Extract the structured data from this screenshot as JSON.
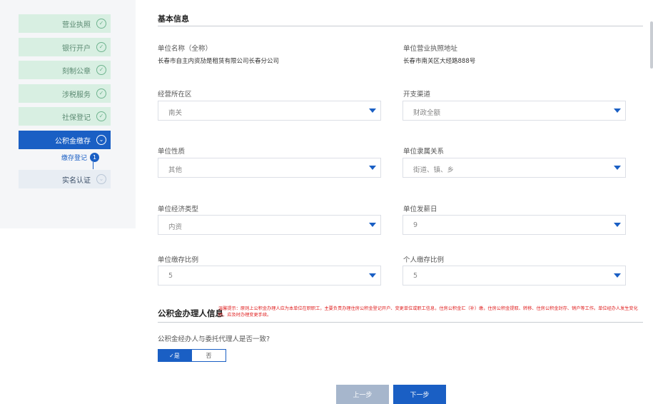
{
  "sidebar": {
    "items": [
      {
        "label": "营业执照",
        "icon": "check-circle-icon",
        "status": "done"
      },
      {
        "label": "银行开户",
        "icon": "check-circle-icon",
        "status": "done"
      },
      {
        "label": "刻制公章",
        "icon": "check-circle-icon",
        "status": "done"
      },
      {
        "label": "涉税服务",
        "icon": "check-circle-icon",
        "status": "done"
      },
      {
        "label": "社保登记",
        "icon": "check-circle-icon",
        "status": "done"
      },
      {
        "label": "公积金缴存",
        "icon": "chevron-down-circle-icon",
        "status": "active"
      },
      {
        "label": "实名认证",
        "icon": "chevron-down-circle-icon",
        "status": "pending"
      }
    ],
    "sub_item": {
      "label": "缴存登记",
      "badge": "1"
    }
  },
  "basic_info": {
    "title": "基本信息",
    "unit_name_label": "单位名称（全称）",
    "unit_name_value": "长春市自主内资劢是租赁有限公司长春分公司",
    "address_label": "单位营业执照地址",
    "address_value": "长春市南关区大经路888号",
    "fields": [
      {
        "label": "经营所在区",
        "value": "南关"
      },
      {
        "label": "开支渠道",
        "value": "财政全额"
      },
      {
        "label": "单位性质",
        "value": "其他"
      },
      {
        "label": "单位隶属关系",
        "value": "街道、镇、乡"
      },
      {
        "label": "单位经济类型",
        "value": "内资"
      },
      {
        "label": "单位发薪日",
        "value": "9"
      },
      {
        "label": "单位缴存比例",
        "value": "5"
      },
      {
        "label": "个人缴存比例",
        "value": "5"
      }
    ]
  },
  "agent_info": {
    "title": "公积金办理人信息",
    "warning": "温馨提示：原则上公积金办理人应为本单位在职职工，主要负责办理住房公积金登记开户、变更单位或职工信息，住房公积金汇（补）缴，住房公积金提取、转移、住房公积金封存、销户等工作。单位经办人发生变化时，应及时办理变更手续。",
    "question": "公积金经办人与委托代理人是否一致?",
    "yes_label": "✓是",
    "no_label": "否"
  },
  "footer": {
    "prev_label": "上一步",
    "next_label": "下一步"
  },
  "colors": {
    "primary": "#1a5fc4",
    "done_bg": "#d8efe2",
    "warning": "#e02020"
  }
}
